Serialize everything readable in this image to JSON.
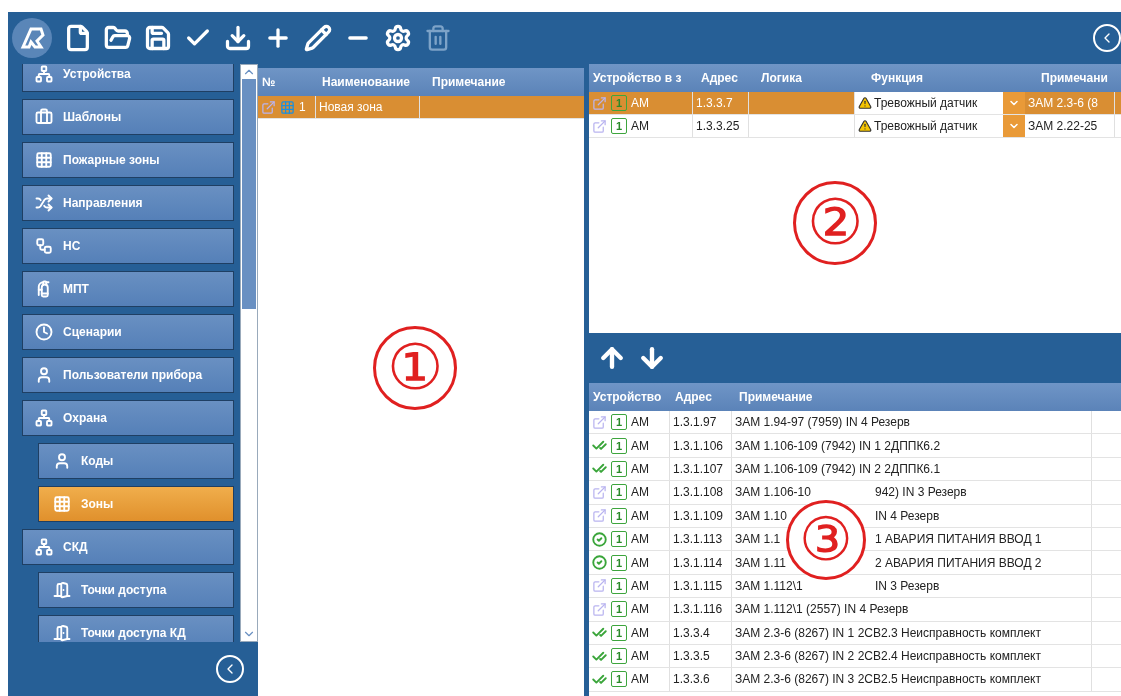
{
  "sidebar": {
    "items": [
      {
        "label": "Устройства",
        "selected": false,
        "sub": false
      },
      {
        "label": "Шаблоны",
        "selected": false,
        "sub": false
      },
      {
        "label": "Пожарные зоны",
        "selected": false,
        "sub": false
      },
      {
        "label": "Направления",
        "selected": false,
        "sub": false
      },
      {
        "label": "НС",
        "selected": false,
        "sub": false
      },
      {
        "label": "МПТ",
        "selected": false,
        "sub": false
      },
      {
        "label": "Сценарии",
        "selected": false,
        "sub": false
      },
      {
        "label": "Пользователи прибора",
        "selected": false,
        "sub": false
      },
      {
        "label": "Охрана",
        "selected": false,
        "sub": false
      },
      {
        "label": "Коды",
        "selected": false,
        "sub": true
      },
      {
        "label": "Зоны",
        "selected": true,
        "sub": true
      },
      {
        "label": "СКД",
        "selected": false,
        "sub": false
      },
      {
        "label": "Точки доступа",
        "selected": false,
        "sub": true
      },
      {
        "label": "Точки доступа КД",
        "selected": false,
        "sub": true
      }
    ]
  },
  "zones_table": {
    "columns": [
      "№",
      "Наименование",
      "Примечание"
    ],
    "rows": [
      {
        "number": "1",
        "name": "Новая зона",
        "selected": true
      }
    ]
  },
  "zone_devices": {
    "columns": [
      "Устройство в з",
      "Адрес",
      "Логика",
      "Функция",
      "Примечани"
    ],
    "rows": [
      {
        "badge": "1",
        "type": "АМ",
        "address": "1.3.3.7",
        "function": "Тревожный датчик",
        "note": "ЗАМ 2.3-6 (8",
        "selected": true
      },
      {
        "badge": "1",
        "type": "АМ",
        "address": "1.3.3.25",
        "function": "Тревожный датчик",
        "note": "ЗАМ 2.22-25",
        "selected": false
      }
    ]
  },
  "devices": {
    "columns": [
      "Устройство",
      "Адрес",
      "Примечание"
    ],
    "rows": [
      {
        "kind": "plain",
        "badge": "1",
        "type": "АМ",
        "address": "1.3.1.97",
        "note": [
          "ЗАМ 1.94-97  (7959) IN 4 Резерв"
        ]
      },
      {
        "kind": "double",
        "badge": "1",
        "type": "АМ",
        "address": "1.3.1.106",
        "note": [
          "ЗАМ 1.106-109  (7942) IN 1 2ДППК6.2"
        ]
      },
      {
        "kind": "double",
        "badge": "1",
        "type": "АМ",
        "address": "1.3.1.107",
        "note": [
          "ЗАМ 1.106-109  (7942) IN 2 2ДППК6.1"
        ]
      },
      {
        "kind": "plain",
        "badge": "1",
        "type": "АМ",
        "address": "1.3.1.108",
        "note": [
          "ЗАМ 1.106-10",
          "942) IN 3 Резерв"
        ]
      },
      {
        "kind": "plain",
        "badge": "1",
        "type": "АМ",
        "address": "1.3.1.109",
        "note": [
          "ЗАМ 1.10",
          "IN 4 Резерв"
        ]
      },
      {
        "kind": "single",
        "badge": "1",
        "type": "АМ",
        "address": "1.3.1.113",
        "note": [
          "ЗАМ 1.1",
          "1 АВАРИЯ ПИТАНИЯ ВВОД 1"
        ]
      },
      {
        "kind": "single",
        "badge": "1",
        "type": "АМ",
        "address": "1.3.1.114",
        "note": [
          "ЗАМ 1.11",
          "2 АВАРИЯ ПИТАНИЯ ВВОД 2"
        ]
      },
      {
        "kind": "plain",
        "badge": "1",
        "type": "АМ",
        "address": "1.3.1.115",
        "note": [
          "ЗАМ 1.112\\1",
          "IN 3 Резерв"
        ]
      },
      {
        "kind": "plain",
        "badge": "1",
        "type": "АМ",
        "address": "1.3.1.116",
        "note": [
          "ЗАМ 1.112\\1  (2557) IN 4 Резерв"
        ]
      },
      {
        "kind": "double",
        "badge": "1",
        "type": "АМ",
        "address": "1.3.3.4",
        "note": [
          "ЗАМ 2.3-6 (8267) IN 1  2СВ2.3 Неисправность комплект"
        ]
      },
      {
        "kind": "double",
        "badge": "1",
        "type": "АМ",
        "address": "1.3.3.5",
        "note": [
          "ЗАМ 2.3-6 (8267) IN 2  2СВ2.4 Неисправность комплект"
        ]
      },
      {
        "kind": "double",
        "badge": "1",
        "type": "АМ",
        "address": "1.3.3.6",
        "note": [
          "ЗАМ 2.3-6 (8267) IN 3  2СВ2.5 Неисправность комплект"
        ]
      }
    ]
  },
  "markers": [
    "①",
    "②",
    "③"
  ]
}
